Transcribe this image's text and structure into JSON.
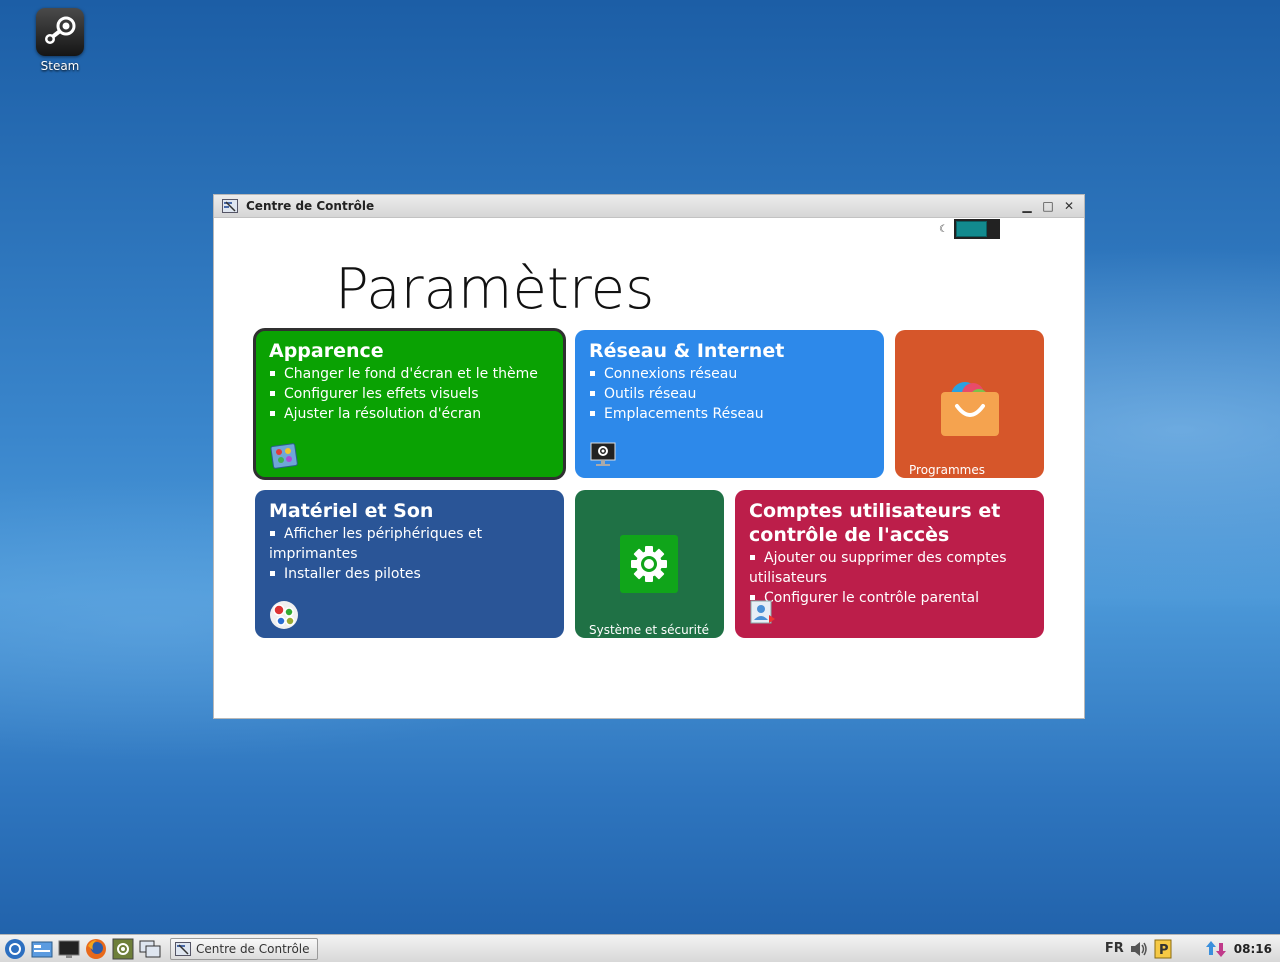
{
  "desktop": {
    "icons": [
      {
        "label": "Steam",
        "icon": "steam-icon"
      }
    ]
  },
  "window": {
    "title": "Centre de Contrôle",
    "controls": {
      "minimize": "▁",
      "maximize": "□",
      "close": "✕"
    },
    "theme_toggle": {
      "icon": "moon-icon",
      "moon": "☾",
      "accent": "#128a8e"
    },
    "heading": "Paramètres"
  },
  "tiles": {
    "appearance": {
      "title": "Apparence",
      "items": [
        "Changer le fond d'écran et le thème",
        "Configurer les effets visuels",
        "Ajuster la résolution d'écran"
      ],
      "color": "#0aa203",
      "icon": "appearance-icon"
    },
    "network": {
      "title": "Réseau & Internet",
      "items": [
        "Connexions réseau",
        "Outils réseau",
        "Emplacements Réseau"
      ],
      "color": "#2d89ea",
      "icon": "network-settings-icon"
    },
    "programs": {
      "caption": "Programmes",
      "color": "#d6562a",
      "icon": "shopping-bag-icon"
    },
    "hardware": {
      "title": "Matériel et Son",
      "items": [
        "Afficher les périphériques et imprimantes",
        "Installer des pilotes"
      ],
      "color": "#2a5597",
      "icon": "hardware-gears-icon"
    },
    "system": {
      "caption": "Système et sécurité",
      "color": "#1f7145",
      "icon": "gear-icon"
    },
    "accounts": {
      "title_line1": "Comptes utilisateurs et",
      "title_line2": "contrôle de l'accès",
      "items": [
        "Ajouter ou supprimer des comptes utilisateurs",
        "Configurer le contrôle parental"
      ],
      "color": "#bc1e4a",
      "icon": "user-account-icon"
    }
  },
  "taskbar": {
    "task_label": "Centre de Contrôle",
    "language": "FR",
    "clock": "08:16",
    "quicklaunch": [
      "start-menu-icon",
      "file-manager-icon",
      "terminal-icon",
      "firefox-icon",
      "control-center-icon",
      "show-desktop-icon"
    ]
  }
}
